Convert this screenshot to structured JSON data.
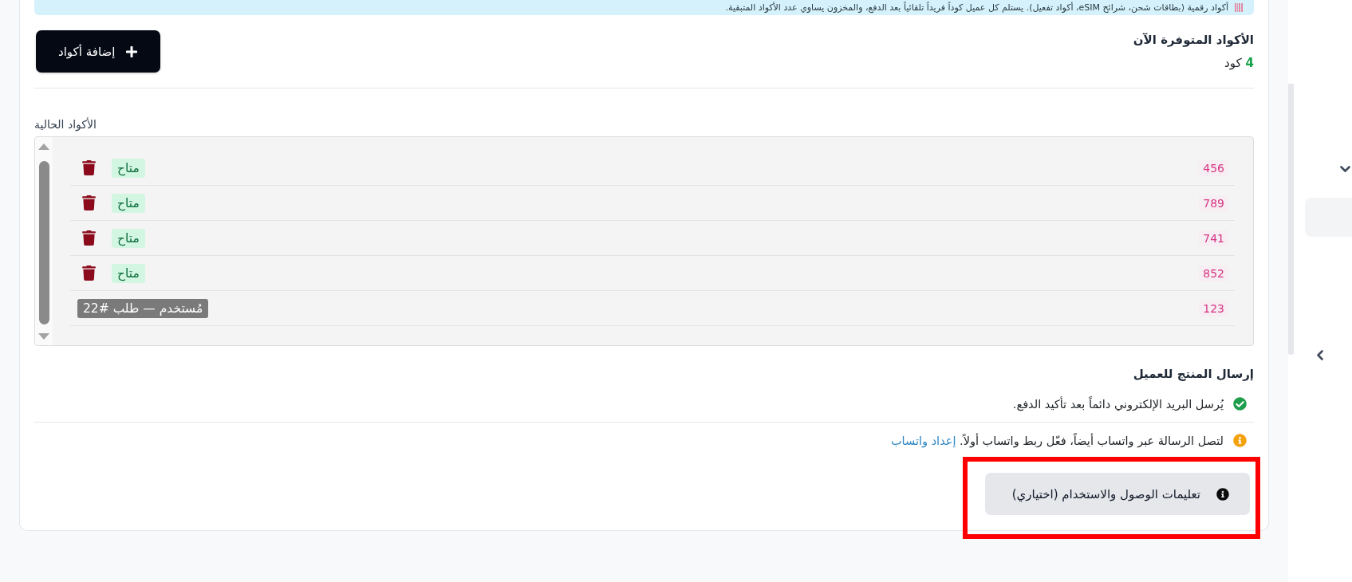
{
  "notice": {
    "text": "أكواد رقمية (بطاقات شحن، شرائح eSIM، أكواد تفعيل). يستلم كل عميل كوداً فريداً تلقائياً بعد الدفع، والمخزون يساوي عدد الأكواد المتبقية."
  },
  "stock": {
    "title": "الأكواد المتوفرة الآن",
    "count": "4",
    "unit": "كود"
  },
  "add_button": {
    "label": "إضافة أكواد"
  },
  "codes": {
    "label": "الأكواد الحالية",
    "rows": [
      {
        "code": "456",
        "status": {
          "kind": "available",
          "label": "متاح"
        }
      },
      {
        "code": "789",
        "status": {
          "kind": "available",
          "label": "متاح"
        }
      },
      {
        "code": "741",
        "status": {
          "kind": "available",
          "label": "متاح"
        }
      },
      {
        "code": "852",
        "status": {
          "kind": "available",
          "label": "متاح"
        }
      },
      {
        "code": "123",
        "status": {
          "kind": "used",
          "label": "مُستخدم — طلب #22"
        }
      }
    ]
  },
  "delivery": {
    "title": "إرسال المنتج للعميل",
    "notes": [
      {
        "kind": "success",
        "text": "يُرسل البريد الإلكتروني دائماً بعد تأكيد الدفع."
      },
      {
        "kind": "warning",
        "text": "لتصل الرسالة عبر واتساب أيضاً، فعّل ربط واتساب أولاً.",
        "link": "إعداد واتساب"
      }
    ]
  },
  "instructions_button": {
    "label": "تعليمات الوصول والاستخدام (اختياري)",
    "highlighted": true
  },
  "sidebar": {
    "items": [
      {
        "kind": "group",
        "expanded": true
      },
      {
        "kind": "link",
        "selected": true
      },
      {
        "kind": "group",
        "expanded": false
      }
    ]
  }
}
